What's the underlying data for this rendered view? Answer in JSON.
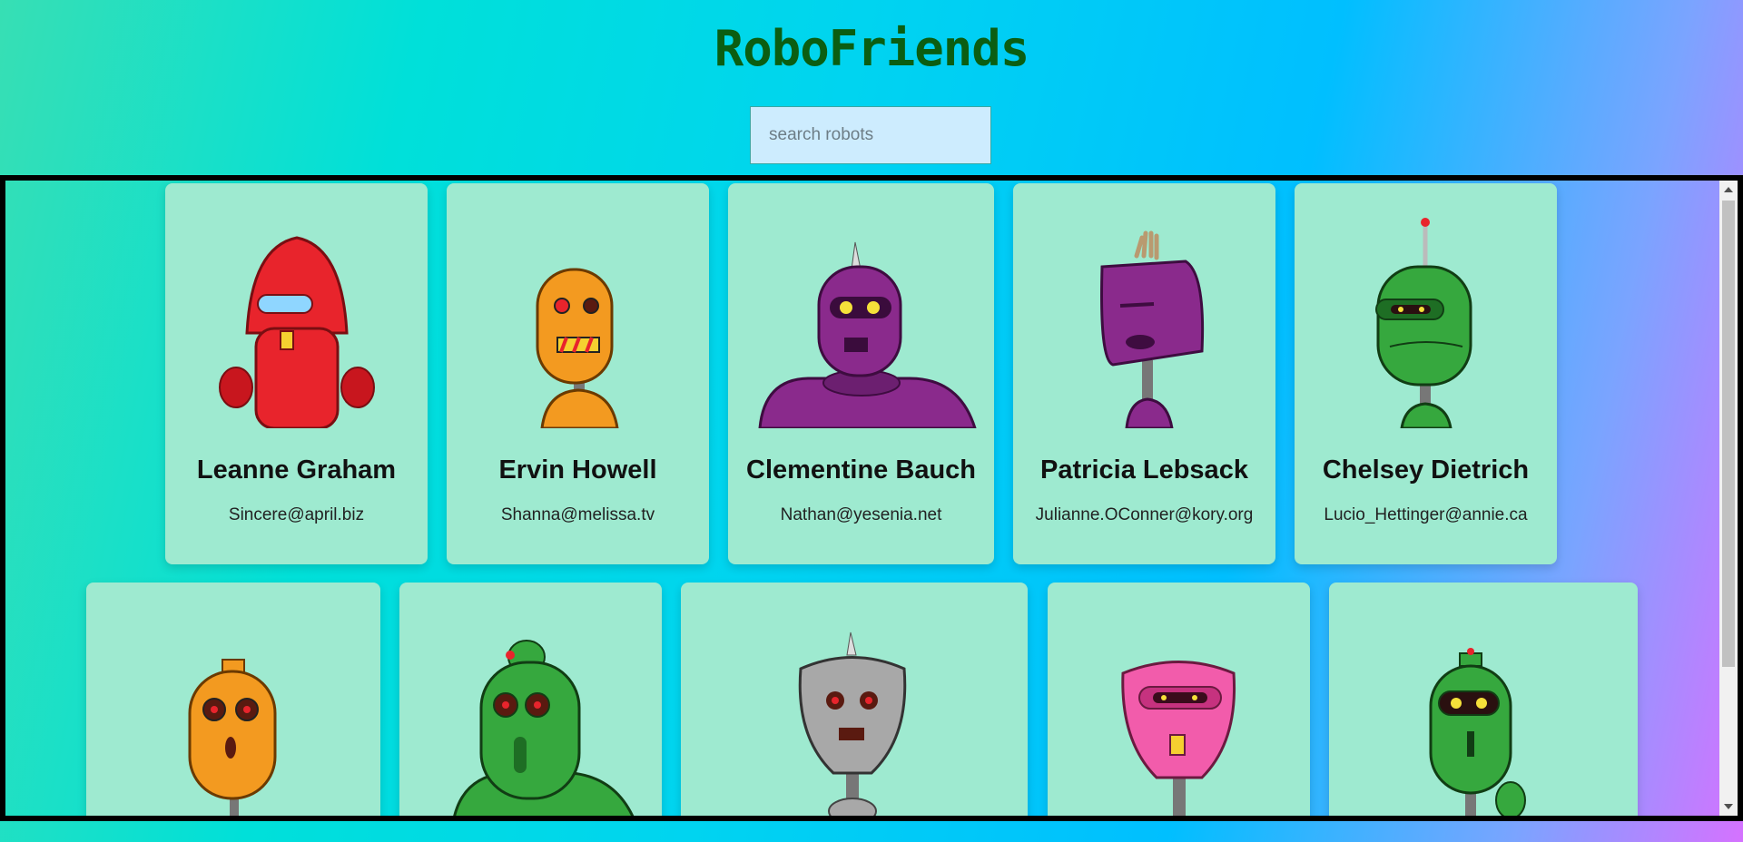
{
  "app": {
    "title": "RoboFriends"
  },
  "search": {
    "placeholder": "search robots",
    "value": ""
  },
  "robots": [
    {
      "name": "Leanne Graham",
      "email": "Sincere@april.biz",
      "color": "#e8242c",
      "icon": "red-robot-avatar"
    },
    {
      "name": "Ervin Howell",
      "email": "Shanna@melissa.tv",
      "color": "#f39a20",
      "icon": "orange-robot-avatar"
    },
    {
      "name": "Clementine Bauch",
      "email": "Nathan@yesenia.net",
      "color": "#8a2a8c",
      "icon": "purple-robot-avatar"
    },
    {
      "name": "Patricia Lebsack",
      "email": "Julianne.OConner@kory.org",
      "color": "#8a2a8c",
      "icon": "purple-robot-avatar"
    },
    {
      "name": "Chelsey Dietrich",
      "email": "Lucio_Hettinger@annie.ca",
      "color": "#36a83e",
      "icon": "green-robot-avatar"
    },
    {
      "name": "",
      "email": "",
      "color": "#f39a20",
      "icon": "orange-robot-avatar"
    },
    {
      "name": "",
      "email": "",
      "color": "#36a83e",
      "icon": "green-robot-avatar"
    },
    {
      "name": "",
      "email": "",
      "color": "#a8a8a8",
      "icon": "gray-robot-avatar"
    },
    {
      "name": "",
      "email": "",
      "color": "#f25cab",
      "icon": "pink-robot-avatar"
    },
    {
      "name": "",
      "email": "",
      "color": "#36a83e",
      "icon": "green-robot-avatar"
    }
  ]
}
